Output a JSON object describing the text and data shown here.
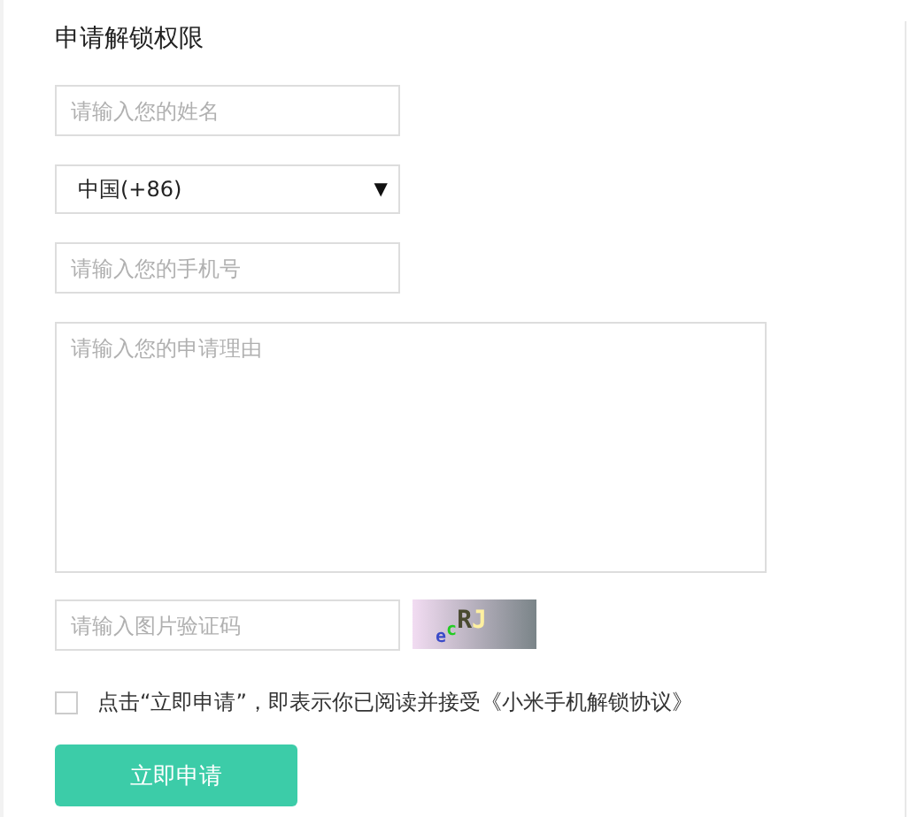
{
  "title": "申请解锁权限",
  "name_field": {
    "placeholder": "请输入您的姓名"
  },
  "country_select": {
    "value": "中国(+86)",
    "arrow": "▼"
  },
  "phone_field": {
    "placeholder": "请输入您的手机号"
  },
  "reason_field": {
    "placeholder": "请输入您的申请理由"
  },
  "captcha_field": {
    "placeholder": "请输入图片验证码"
  },
  "captcha": [
    {
      "text": "e",
      "color": "#3b4bc8"
    },
    {
      "text": "c",
      "color": "#22cc22"
    },
    {
      "text": "R",
      "color": "#4a4a30"
    },
    {
      "text": "J",
      "color": "#fff0a0"
    }
  ],
  "agreement": {
    "checked": false,
    "text": "点击“立即申请”，即表示你已阅读并接受",
    "link": "《小米手机解锁协议》"
  },
  "submit": "立即申请"
}
